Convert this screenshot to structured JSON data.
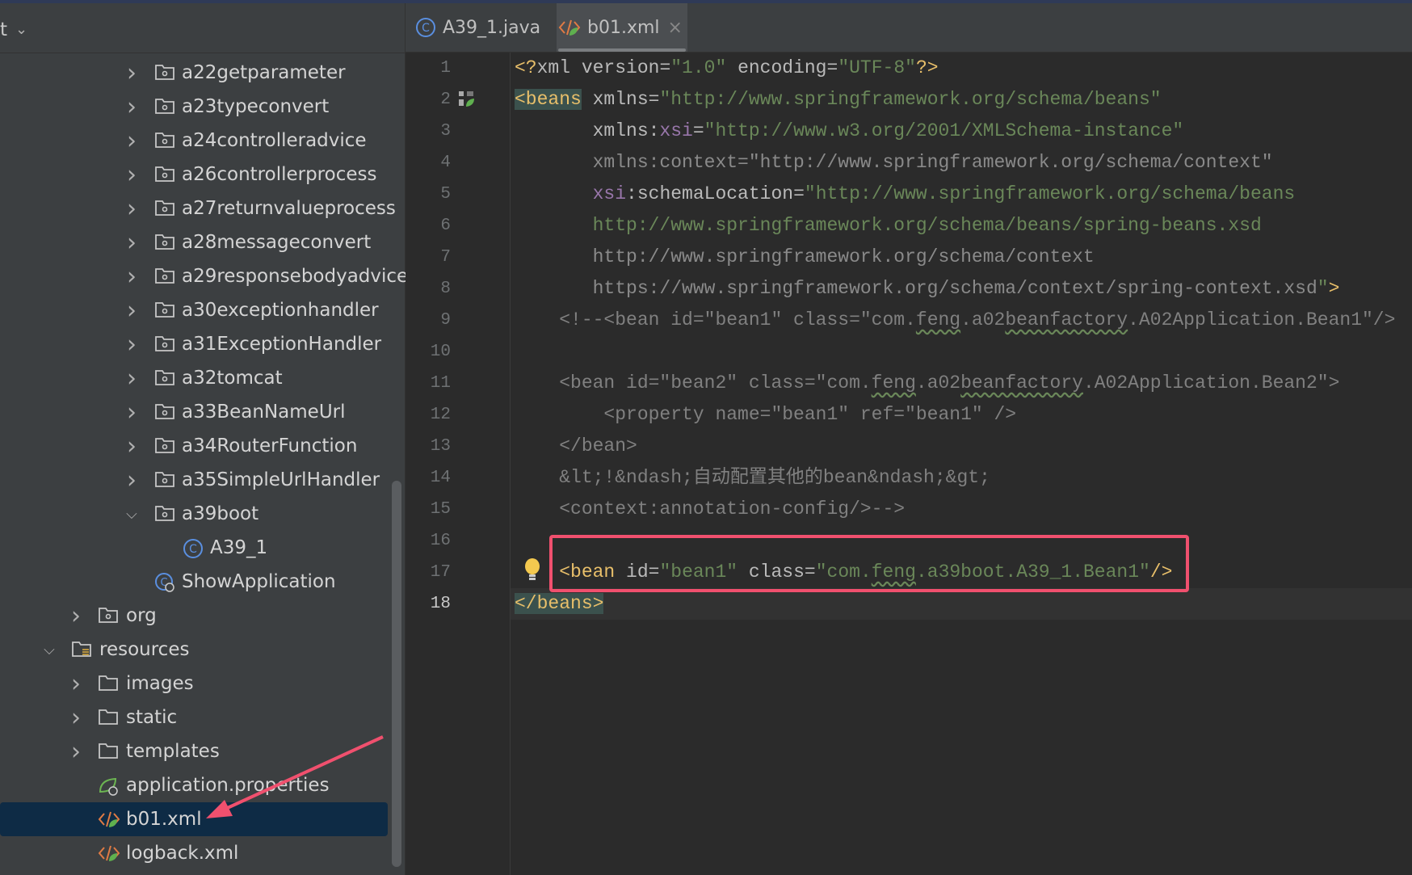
{
  "project_header": {
    "label": "t",
    "chevron": "chevron-down-icon"
  },
  "tree": [
    {
      "label": "a22getparameter",
      "type": "package",
      "level": 3,
      "expanded": false
    },
    {
      "label": "a23typeconvert",
      "type": "package",
      "level": 3,
      "expanded": false
    },
    {
      "label": "a24controlleradvice",
      "type": "package",
      "level": 3,
      "expanded": false
    },
    {
      "label": "a26controllerprocess",
      "type": "package",
      "level": 3,
      "expanded": false
    },
    {
      "label": "a27returnvalueprocess",
      "type": "package",
      "level": 3,
      "expanded": false
    },
    {
      "label": "a28messageconvert",
      "type": "package",
      "level": 3,
      "expanded": false
    },
    {
      "label": "a29responsebodyadvice",
      "type": "package",
      "level": 3,
      "expanded": false
    },
    {
      "label": "a30exceptionhandler",
      "type": "package",
      "level": 3,
      "expanded": false
    },
    {
      "label": "a31ExceptionHandler",
      "type": "package",
      "level": 3,
      "expanded": false
    },
    {
      "label": "a32tomcat",
      "type": "package",
      "level": 3,
      "expanded": false
    },
    {
      "label": "a33BeanNameUrl",
      "type": "package",
      "level": 3,
      "expanded": false
    },
    {
      "label": "a34RouterFunction",
      "type": "package",
      "level": 3,
      "expanded": false
    },
    {
      "label": "a35SimpleUrlHandler",
      "type": "package",
      "level": 3,
      "expanded": false
    },
    {
      "label": "a39boot",
      "type": "package",
      "level": 3,
      "expanded": true
    },
    {
      "label": "A39_1",
      "type": "class",
      "level": 4
    },
    {
      "label": "ShowApplication",
      "type": "spring-class",
      "level": 3
    },
    {
      "label": "org",
      "type": "package",
      "level": 2,
      "expanded": false
    },
    {
      "label": "resources",
      "type": "resources",
      "level": 1,
      "expanded": true
    },
    {
      "label": "images",
      "type": "folder",
      "level": 2,
      "expanded": false
    },
    {
      "label": "static",
      "type": "folder",
      "level": 2,
      "expanded": false
    },
    {
      "label": "templates",
      "type": "folder",
      "level": 2,
      "expanded": false
    },
    {
      "label": "application.properties",
      "type": "spring-properties",
      "level": 2
    },
    {
      "label": "b01.xml",
      "type": "xml",
      "level": 2,
      "selected": true
    },
    {
      "label": "logback.xml",
      "type": "xml",
      "level": 2
    }
  ],
  "tabs": [
    {
      "label": "A39_1.java",
      "icon": "class-icon",
      "active": false
    },
    {
      "label": "b01.xml",
      "icon": "xml-icon",
      "active": true,
      "close": "×"
    }
  ],
  "editor": {
    "current_line": 18,
    "line_numbers": [
      "1",
      "2",
      "3",
      "4",
      "5",
      "6",
      "7",
      "8",
      "9",
      "10",
      "11",
      "12",
      "13",
      "14",
      "15",
      "16",
      "17",
      "18"
    ],
    "lines": [
      [
        [
          "tag",
          "<?"
        ],
        [
          "attr",
          "xml version"
        ],
        [
          "pun",
          "="
        ],
        [
          "val",
          "\"1.0\""
        ],
        [
          "attr",
          " encoding"
        ],
        [
          "pun",
          "="
        ],
        [
          "val",
          "\"UTF-8\""
        ],
        [
          "tag",
          "?>"
        ]
      ],
      [
        [
          "tag hl",
          "<beans"
        ],
        [
          "attr",
          " xmlns"
        ],
        [
          "pun",
          "="
        ],
        [
          "val",
          "\"http://www.springframework.org/schema/beans\""
        ]
      ],
      [
        [
          "attr",
          "       xmlns:"
        ],
        [
          "ns",
          "xsi"
        ],
        [
          "pun",
          "="
        ],
        [
          "val",
          "\"http://www.w3.org/2001/XMLSchema-instance\""
        ]
      ],
      [
        [
          "dim",
          "       xmlns:context=\"http://www.springframework.org/schema/context\""
        ]
      ],
      [
        [
          "ns",
          "       xsi"
        ],
        [
          "attr",
          ":schemaLocation"
        ],
        [
          "pun",
          "="
        ],
        [
          "val",
          "\"http://www.springframework.org/schema/beans"
        ]
      ],
      [
        [
          "val",
          "       http://www.springframework.org/schema/beans/spring-beans.xsd"
        ]
      ],
      [
        [
          "dim",
          "       http://www.springframework.org/schema/context"
        ]
      ],
      [
        [
          "dim",
          "       https://www.springframework.org/schema/context/spring-context.xsd"
        ],
        [
          "val",
          "\""
        ],
        [
          "tag",
          ">"
        ]
      ],
      [
        [
          "com",
          "    <!--<bean id=\"bean1\" class=\"com."
        ],
        [
          "com wavy",
          "feng"
        ],
        [
          "com",
          ".a02"
        ],
        [
          "com wavy",
          "beanfactory"
        ],
        [
          "com",
          ".A02Application.Bean1\"/>"
        ]
      ],
      [],
      [
        [
          "com",
          "    <bean id=\"bean2\" class=\"com."
        ],
        [
          "com wavy",
          "feng"
        ],
        [
          "com",
          ".a02"
        ],
        [
          "com wavy",
          "beanfactory"
        ],
        [
          "com",
          ".A02Application.Bean2\">"
        ]
      ],
      [
        [
          "com",
          "        <property name=\"bean1\" ref=\"bean1\" />"
        ]
      ],
      [
        [
          "com",
          "    </bean>"
        ]
      ],
      [
        [
          "com",
          "    &lt;!&ndash;自动配置其他的bean&ndash;&gt;"
        ]
      ],
      [
        [
          "com",
          "    <context:annotation-config/>-->"
        ]
      ],
      [],
      [
        [
          "tag",
          "    <bean"
        ],
        [
          "attr",
          " id"
        ],
        [
          "pun",
          "="
        ],
        [
          "val",
          "\"bean1\""
        ],
        [
          "attr",
          " class"
        ],
        [
          "pun",
          "="
        ],
        [
          "val",
          "\"com."
        ],
        [
          "val wavy",
          "feng"
        ],
        [
          "val",
          ".a39boot.A39_1.Bean1\""
        ],
        [
          "tag",
          "/>"
        ]
      ],
      [
        [
          "tag hl",
          "</beans>"
        ]
      ]
    ]
  },
  "colors": {
    "tag": "#e8bf6a",
    "value": "#6a8759",
    "comment": "#808080",
    "namespace": "#9876aa",
    "highlight_box": "#f0506e",
    "selection": "#0e2b45"
  }
}
